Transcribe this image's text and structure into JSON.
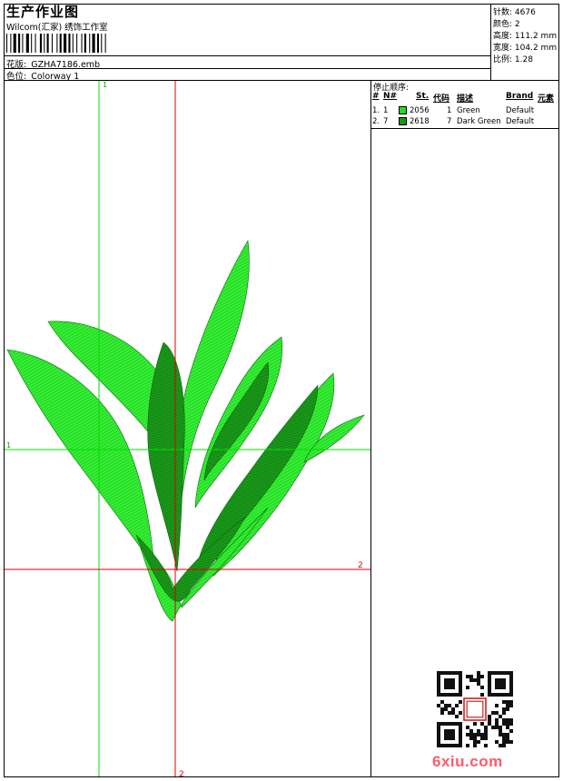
{
  "header": {
    "title": "生产作业图",
    "company": "Wilcom(汇家) 绣饰工作室",
    "design_label": "花版:",
    "design_value": "GZHA7186.emb",
    "colorway_label": "色位:",
    "colorway_value": "Colorway 1"
  },
  "stats": [
    {
      "label": "针数:",
      "value": "4676"
    },
    {
      "label": "颜色:",
      "value": "2"
    },
    {
      "label": "高度:",
      "value": "111.2 mm"
    },
    {
      "label": "宽度:",
      "value": "104.2 mm"
    },
    {
      "label": "比例:",
      "value": "1.28"
    }
  ],
  "stop_sequence": {
    "title": "停止顺序:",
    "headers": [
      "#",
      "N#",
      "St.",
      "代码",
      "描述",
      "Brand",
      "元素"
    ],
    "rows": [
      {
        "index": "1.",
        "needle": "1",
        "stitches": "2056",
        "code": "1",
        "description": "Green",
        "brand": "Default",
        "color": "#22dd22"
      },
      {
        "index": "2.",
        "needle": "7",
        "stitches": "2618",
        "code": "7",
        "description": "Dark Green",
        "brand": "Default",
        "color": "#119911"
      }
    ]
  },
  "guides": {
    "v_green": "1",
    "h_green": "1",
    "h_red": "2",
    "v_red": "2",
    "green_color": "#00dd00",
    "red_color": "#dd0000"
  },
  "colors": {
    "leaf_light": "#22dd22",
    "leaf_dark": "#119911",
    "watermark": "#ff5a6a"
  },
  "watermark": "6xiu.com"
}
